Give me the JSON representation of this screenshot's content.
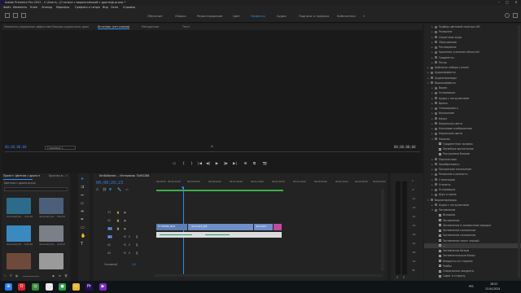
{
  "window": {
    "title": "Adobe Premiere Pro 2022 - C:\\Users\\...\\Статика с видеосъёмкой с дрона\\ф.prproj *",
    "minimize": "–",
    "maximize": "□",
    "close": "✕"
  },
  "menu": [
    "Файл",
    "Изменить",
    "Клип",
    "Эпизод",
    "Маркеры",
    "Графика и титры",
    "Вид",
    "Окно",
    "Справка"
  ],
  "workspaces": {
    "items": [
      "Обучение",
      "Сборка",
      "Редактирование",
      "Цвет",
      "Эффекты",
      "Аудио",
      "Подписи и графика",
      "Библиотеки"
    ],
    "active_index": 4,
    "more": "»"
  },
  "monitor": {
    "tabs": [
      "Элементы управления эффектами",
      "Микшер аудиоклипа: дрон",
      "Источник: (нет клипов)",
      "Метаданные",
      "Текст"
    ],
    "active_tab": 2,
    "timecode_left": "00;00;00;00",
    "page_label": "Страница 1",
    "timecode_right": "00;00;00;00",
    "controls": [
      "◁",
      "{",
      "}",
      "|◀",
      "◀|",
      "▶",
      "|▶",
      "▶|",
      "⊞",
      "⧉",
      "📷"
    ]
  },
  "project": {
    "tab_project": "Проект: Цветная с дрона ▾",
    "tab_browser": "Браузер м...",
    "more": "»",
    "search_placeholder": "",
    "file_label": "Цветная с дрона.prproj",
    "items": [
      {
        "name": "document_01...",
        "duration": "4:14:10",
        "color": "#2d6b8a"
      },
      {
        "name": "document_02...",
        "duration": "0:22:15",
        "color": "#4c5f7a"
      },
      {
        "name": "document_03...",
        "duration": "5:09:02",
        "color": "#3b8abf"
      },
      {
        "name": "document_04...",
        "duration": "4:14:13",
        "color": "#7a7f88"
      },
      {
        "name": "",
        "duration": "",
        "color": "#6e4a3a"
      },
      {
        "name": "",
        "duration": "",
        "color": "#9a9a9a"
      }
    ]
  },
  "timeline": {
    "tab_label": "БезБаКиное ... Интервалы 74492288",
    "timecode": "00;00;20;23",
    "ruler": [
      "00;00;00",
      "00;00;12;00",
      "00;00;30;00",
      "00;00;44;02",
      "00;01;00;00",
      "00;01;14;02",
      "00;01;30;00",
      "00;01;44;02",
      "00;02;00;00",
      "00;02;14;02",
      "00;02;30;00",
      "00;02;44;02"
    ],
    "tracks": [
      {
        "name": "V3",
        "type": "video"
      },
      {
        "name": "V2",
        "type": "video"
      },
      {
        "name": "V1",
        "type": "video"
      },
      {
        "name": "A1",
        "type": "audio"
      },
      {
        "name": "A2",
        "type": "audio"
      },
      {
        "name": "A3",
        "type": "audio"
      }
    ],
    "master_label": "Основной",
    "master_value": "0,0",
    "clips": [
      {
        "label": "FX DRONE_0001",
        "color": "#5b7fb5"
      },
      {
        "label": "document_028",
        "color": "#6f8fc8"
      },
      {
        "label": "document",
        "color": "#6f8fc8"
      },
      {
        "label": "",
        "color": "#c24aa2"
      }
    ]
  },
  "meters": {
    "scale": [
      "0",
      "-6",
      "-12",
      "-18",
      "-24",
      "-30",
      "-36",
      "-42",
      "-48",
      "-54",
      "dB"
    ],
    "solo": "S",
    "solo2": "S"
  },
  "effects": {
    "rows": [
      {
        "indent": 1,
        "kind": "folder",
        "label": "Подбор цветовой палитры HD",
        "open": false
      },
      {
        "indent": 1,
        "kind": "folder",
        "label": "Размытие",
        "open": false
      },
      {
        "indent": 1,
        "kind": "folder",
        "label": "Секретные ходы",
        "open": false
      },
      {
        "indent": 1,
        "kind": "folder",
        "label": "Сбросивание",
        "open": false
      },
      {
        "indent": 1,
        "kind": "folder",
        "label": "Растворения",
        "open": false
      },
      {
        "indent": 1,
        "kind": "folder",
        "label": "Удаление усиления областей",
        "open": false
      },
      {
        "indent": 1,
        "kind": "folder",
        "label": "Градиенты",
        "open": false
      },
      {
        "indent": 1,
        "kind": "folder",
        "label": "Ретро",
        "open": false
      },
      {
        "indent": 0,
        "kind": "folder",
        "label": "Шаблоны набора Lumetri",
        "open": false
      },
      {
        "indent": 0,
        "kind": "folder",
        "label": "Аудиоэффекты",
        "open": false
      },
      {
        "indent": 0,
        "kind": "folder",
        "label": "Аудиопереходы",
        "open": false
      },
      {
        "indent": 0,
        "kind": "folder",
        "label": "Видеоэффекты",
        "open": true
      },
      {
        "indent": 1,
        "kind": "folder",
        "label": "Видео",
        "open": false
      },
      {
        "indent": 1,
        "kind": "folder",
        "label": "Устаревшие",
        "open": false
      },
      {
        "indent": 1,
        "kind": "folder",
        "label": "Аудио с погружением",
        "open": false
      },
      {
        "indent": 1,
        "kind": "folder",
        "label": "Время",
        "open": false
      },
      {
        "indent": 1,
        "kind": "folder",
        "label": "Генерировать",
        "open": false
      },
      {
        "indent": 1,
        "kind": "folder",
        "label": "Искажение",
        "open": false
      },
      {
        "indent": 1,
        "kind": "folder",
        "label": "Канал",
        "open": false
      },
      {
        "indent": 1,
        "kind": "folder",
        "label": "Коррекция цвета",
        "open": false
      },
      {
        "indent": 1,
        "kind": "folder",
        "label": "Ключевые изображения",
        "open": false
      },
      {
        "indent": 1,
        "kind": "folder",
        "label": "Коррекция цвета",
        "open": false
      },
      {
        "indent": 1,
        "kind": "folder",
        "label": "Перенос",
        "open": true
      },
      {
        "indent": 2,
        "kind": "fx",
        "label": "Градиентная заливка",
        "open": false
      },
      {
        "indent": 2,
        "kind": "fx",
        "label": "Линейное вытеснение",
        "open": false
      },
      {
        "indent": 2,
        "kind": "fx",
        "label": "Растушевка блоков",
        "open": false
      },
      {
        "indent": 1,
        "kind": "folder",
        "label": "Перспектива",
        "open": false
      },
      {
        "indent": 1,
        "kind": "folder",
        "label": "Преобразовать",
        "open": false
      },
      {
        "indent": 1,
        "kind": "folder",
        "label": "Прозрачное наложение",
        "open": false
      },
      {
        "indent": 1,
        "kind": "folder",
        "label": "Размытие и резкость",
        "open": false
      },
      {
        "indent": 1,
        "kind": "folder",
        "label": "Стилизация",
        "open": false
      },
      {
        "indent": 1,
        "kind": "folder",
        "label": "Утилиты",
        "open": false
      },
      {
        "indent": 1,
        "kind": "folder",
        "label": "Устаревшие",
        "open": false
      },
      {
        "indent": 1,
        "kind": "folder",
        "label": "Шум и зерно",
        "open": false
      },
      {
        "indent": 0,
        "kind": "folder",
        "label": "Видеопереходы",
        "open": true
      },
      {
        "indent": 1,
        "kind": "folder",
        "label": "Аудио с погружением",
        "open": false
      },
      {
        "indent": 1,
        "kind": "folder",
        "label": "Затемнение",
        "open": true
      },
      {
        "indent": 2,
        "kind": "fx",
        "label": "Вспышка",
        "open": false
      },
      {
        "indent": 2,
        "kind": "fx",
        "label": "Затемнение",
        "open": false
      },
      {
        "indent": 2,
        "kind": "fx",
        "label": "Затемнение в заливочном порядке",
        "open": false
      },
      {
        "indent": 2,
        "kind": "fx",
        "label": "Затемнение наложение",
        "open": false
      },
      {
        "indent": 2,
        "kind": "fx",
        "label": "Затемнение наложение",
        "open": false
      },
      {
        "indent": 2,
        "kind": "fx",
        "label": "Затемнение через черный",
        "open": false
      },
      {
        "indent": 2,
        "kind": "fx",
        "label": "...",
        "open": false,
        "selected": true
      },
      {
        "indent": 2,
        "kind": "fx",
        "label": "Затемнение белым",
        "open": false
      },
      {
        "indent": 2,
        "kind": "fx",
        "label": "Затемнительные блоки",
        "open": false
      },
      {
        "indent": 2,
        "kind": "fx",
        "label": "Квадраты со стороны",
        "open": false
      },
      {
        "indent": 2,
        "kind": "fx",
        "label": "Ромбы",
        "open": false
      },
      {
        "indent": 2,
        "kind": "fx",
        "label": "Спиральные квадраты",
        "open": false
      },
      {
        "indent": 2,
        "kind": "fx",
        "label": "Сдвиг в сторону",
        "open": false
      }
    ]
  },
  "taskbar": {
    "time": "18:22",
    "date": "13.04.2024",
    "lang": "РУС",
    "icons": [
      {
        "name": "windows-icon",
        "glyph": "⊞",
        "color": "#2b7de9"
      },
      {
        "name": "opera-icon",
        "glyph": "O",
        "color": "#d8262c"
      },
      {
        "name": "app-icon",
        "glyph": "◎",
        "color": "#3a8a3a"
      },
      {
        "name": "yandex-icon",
        "glyph": "Y",
        "color": "#e8e8e8"
      },
      {
        "name": "chrome-icon",
        "glyph": "●",
        "color": "#2a9d4a"
      },
      {
        "name": "explorer-icon",
        "glyph": "▭",
        "color": "#e5b53a"
      },
      {
        "name": "premiere-icon",
        "glyph": "Pr",
        "color": "#2a0d5c"
      },
      {
        "name": "media-icon",
        "glyph": "▶",
        "color": "#7b2cbf"
      }
    ]
  }
}
